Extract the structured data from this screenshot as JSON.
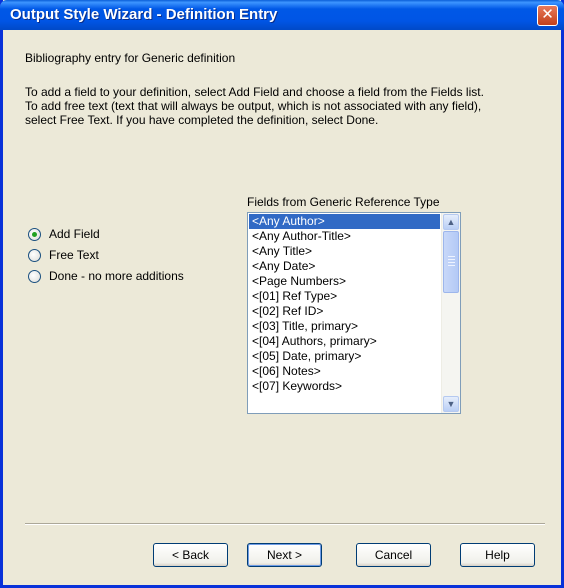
{
  "window": {
    "title": "Output Style Wizard - Definition Entry",
    "close_glyph": "✕"
  },
  "intro": "Bibliography entry for Generic definition",
  "instructions": "To add a field to your definition, select Add Field and choose a field from the Fields list. To add free text (text that will always be output, which is not associated with any field), select Free Text. If you have completed the definition, select Done.",
  "options": [
    {
      "label": "Add Field",
      "checked": true
    },
    {
      "label": "Free Text",
      "checked": false
    },
    {
      "label": "Done - no more additions",
      "checked": false
    }
  ],
  "fields_label": "Fields from Generic Reference Type",
  "fields": [
    "<Any Author>",
    "<Any Author-Title>",
    "<Any Title>",
    "<Any Date>",
    "<Page Numbers>",
    "<[01] Ref Type>",
    "<[02] Ref ID>",
    "<[03] Title, primary>",
    "<[04] Authors, primary>",
    "<[05] Date, primary>",
    "<[06] Notes>",
    "<[07] Keywords>"
  ],
  "selected_field": "<Any Author>",
  "buttons": {
    "back": "< Back",
    "next": "Next >",
    "cancel": "Cancel",
    "help": "Help"
  },
  "icons": {
    "scroll_up": "up-arrow-icon",
    "scroll_down": "down-arrow-icon"
  },
  "colors": {
    "title_bar": "#0055E5",
    "dialog_bg": "#ECE9D8",
    "selection": "#316AC5",
    "close_button": "#C2401B"
  }
}
